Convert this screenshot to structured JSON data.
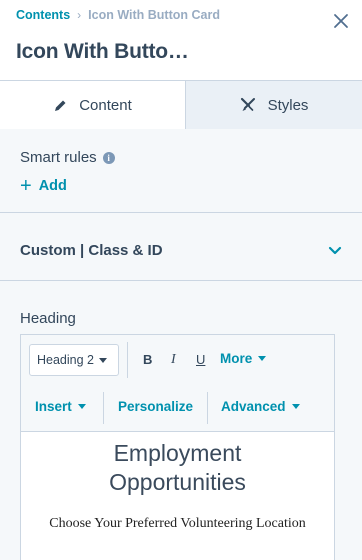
{
  "breadcrumb": {
    "root": "Contents",
    "separator": "›",
    "current": "Icon With Button Card"
  },
  "page_title": "Icon With Butto…",
  "tabs": [
    {
      "label": "Content",
      "icon": "pencil-icon",
      "active": true
    },
    {
      "label": "Styles",
      "icon": "brush-icon",
      "active": false
    }
  ],
  "smart_rules": {
    "label": "Smart rules",
    "info_glyph": "i",
    "add_label": "Add",
    "add_glyph": "+"
  },
  "custom_section": {
    "label": "Custom | Class & ID"
  },
  "heading_section": {
    "label": "Heading",
    "toolbar": {
      "style_select": "Heading 2",
      "bold": "B",
      "italic": "I",
      "underline": "U",
      "more": "More",
      "insert": "Insert",
      "personalize": "Personalize",
      "advanced": "Advanced"
    },
    "content": {
      "heading_line1": "Employment",
      "heading_line2": "Opportunities",
      "subheading": "Choose Your Preferred Volunteering Location"
    }
  },
  "colors": {
    "accent": "#0091ae",
    "text": "#33475b",
    "border": "#cbd6e2",
    "panel_bg": "#f5f8fa",
    "inactive_tab_bg": "#eaf0f6"
  }
}
